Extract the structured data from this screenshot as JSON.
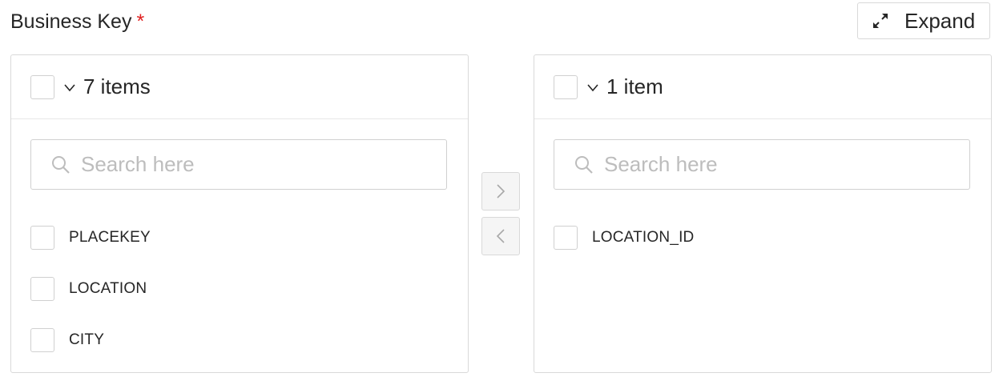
{
  "field": {
    "label": "Business Key",
    "required_mark": "*"
  },
  "expand_button": {
    "label": "Expand",
    "icon": "expand-arrows-icon"
  },
  "source_panel": {
    "count_label": "7 items",
    "search_placeholder": "Search here",
    "items": [
      {
        "label": "PLACEKEY"
      },
      {
        "label": "LOCATION"
      },
      {
        "label": "CITY"
      }
    ]
  },
  "target_panel": {
    "count_label": "1 item",
    "search_placeholder": "Search here",
    "items": [
      {
        "label": "LOCATION_ID"
      }
    ]
  },
  "transfer": {
    "to_right_icon": "chevron-right-icon",
    "to_left_icon": "chevron-left-icon"
  },
  "colors": {
    "required": "#e02020",
    "border": "#d9d9d9",
    "placeholder": "#bdbdbd"
  }
}
